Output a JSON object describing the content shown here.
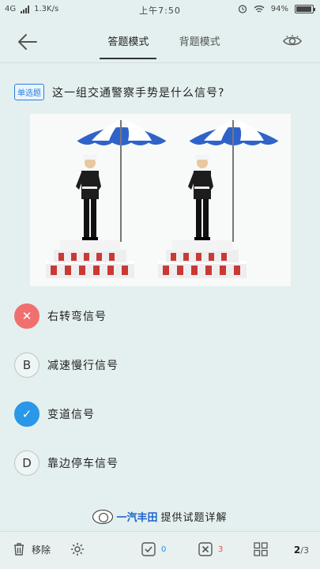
{
  "status": {
    "network": "4G",
    "speed": "1.3K/s",
    "time": "上午7:50",
    "battery": "94%",
    "battery_level": 0.94
  },
  "nav": {
    "tabs": [
      {
        "label": "答题模式",
        "active": true
      },
      {
        "label": "背题模式",
        "active": false
      }
    ]
  },
  "question": {
    "type": "单选题",
    "text": "这一组交通警察手势是什么信号?"
  },
  "options": [
    {
      "badge": "✕",
      "state": "wrong",
      "text": "右转弯信号"
    },
    {
      "badge": "B",
      "state": "normal",
      "text": "减速慢行信号"
    },
    {
      "badge": "✓",
      "state": "correct",
      "text": "变道信号"
    },
    {
      "badge": "D",
      "state": "normal",
      "text": "靠边停车信号"
    }
  ],
  "sponsor": {
    "brand": "一汽丰田",
    "text": "提供试题详解"
  },
  "toolbar": {
    "remove_label": "移除",
    "correct_count": "0",
    "wrong_count": "3",
    "page_current": "2",
    "page_total": "/3"
  },
  "colors": {
    "background": "#e4f0ef",
    "wrong": "#f07070",
    "correct": "#2a97e8",
    "brand": "#1d63c8"
  }
}
